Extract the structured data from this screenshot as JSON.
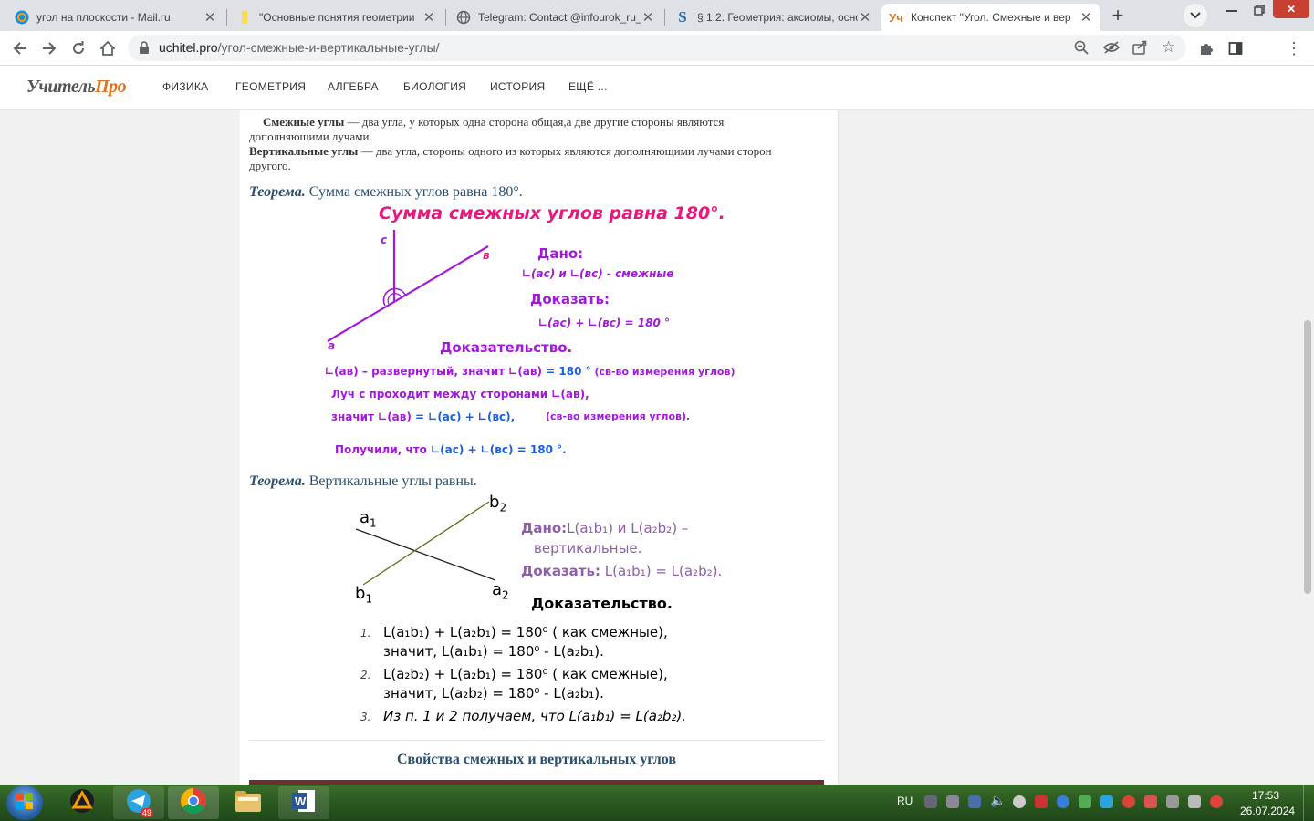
{
  "browser": {
    "tabs": [
      {
        "title": "угол на плоскости - Mail.ru",
        "icon": "mailru-at-icon"
      },
      {
        "title": "\"Основные понятия геометрии",
        "icon": "yandex-doc-icon"
      },
      {
        "title": "Telegram: Contact @infourok_ru_",
        "icon": "globe-icon"
      },
      {
        "title": "§ 1.2. Геометрия: аксиомы, осно",
        "icon": "s-logo-icon"
      },
      {
        "title": "Конспект \"Угол. Смежные и вер",
        "icon": "uchitel-icon",
        "favicon_text": "Уч"
      }
    ],
    "url_host": "uchitel.pro",
    "url_path": "/угол-смежные-и-вертикальные-углы/"
  },
  "site": {
    "logo_a": "Учитель",
    "logo_b": "Про",
    "nav": [
      "ФИЗИКА",
      "ГЕОМЕТРИЯ",
      "АЛГЕБРА",
      "БИОЛОГИЯ",
      "ИСТОРИЯ",
      "ЕЩЁ ..."
    ]
  },
  "article": {
    "def1_term": "Смежные углы",
    "def1_rest_line1": " — два угла, у которых одна сторона общая,а две другие стороны являются",
    "def1_line2": "дополняющими лучами.",
    "def2_term": "Вертикальные углы",
    "def2_rest_line1": " — два угла, стороны одного из которых являются дополняющими лучами сторон",
    "def2_line2": "другого.",
    "theorem_word": "Теорема.",
    "theorem1": " Сумма смежных углов равна 180°.",
    "theorem2": " Вертикальные углы равны.",
    "section_title": "Свойства смежных и вертикальных углов"
  },
  "figure1": {
    "title": "Сумма смежных  углов равна 180°.",
    "label_c": "с",
    "label_b": "в",
    "label_a": "а",
    "given_title": "Дано:",
    "given_line": "∟(ас)  и ∟(вс) - смежные",
    "prove_title": "Доказать:",
    "prove_line": "∟(ас)  + ∟(вс) = 180 °",
    "proof_title": "Доказательство.",
    "p1_a": "∟(ав) – развернутый,  значит ∟(ав)",
    "p1_b": " = 180 °",
    "p1_c": " (св-во измерения углов)",
    "p2": "Луч с проходит между сторонами   ∟(ав),",
    "p3_a": "значит ∟(ав)",
    "p3_b": "  = ∟(ас)  + ∟(вс),",
    "p3_c": "(св-во измерения углов).",
    "p4_a": "Получили, что ",
    "p4_b": "∟(ас)  + ∟(вс) = 180 °."
  },
  "figure2": {
    "label_a1": "a",
    "label_b2": "b",
    "label_b1": "b",
    "label_a2": "a",
    "sub1": "1",
    "sub2": "2",
    "given_title": "Дано:",
    "given_line1": "L(a₁b₁) и L(a₂b₂) –",
    "given_line2": "вертикальные.",
    "prove_title": "Доказать:",
    "prove_line": " L(a₁b₁) = L(a₂b₂).",
    "proof_title": "Доказательство.",
    "n1": "1.",
    "n2": "2.",
    "n3": "3.",
    "s1_line1": "L(a₁b₁) + L(a₂b₁) = 180⁰ ( как смежные),",
    "s1_line2": "значит, L(a₁b₁) = 180⁰ - L(a₂b₁).",
    "s2_line1": "L(a₂b₂) + L(a₂b₁) = 180⁰ ( как смежные),",
    "s2_line2": "значит, L(a₂b₂) = 180⁰ - L(a₂b₁).",
    "s3": "Из п. 1 и 2 получаем, что L(a₁b₁) = L(a₂b₂)."
  },
  "taskbar": {
    "lang": "RU",
    "time": "17:53",
    "date": "26.07.2024",
    "telegram_badge": "49"
  },
  "colors": {
    "magenta": "#e6197e",
    "purple": "#a11ad9",
    "blue": "#1a5fe0",
    "theorem": "#2c4f6e",
    "dano": "#8e5fa8"
  }
}
